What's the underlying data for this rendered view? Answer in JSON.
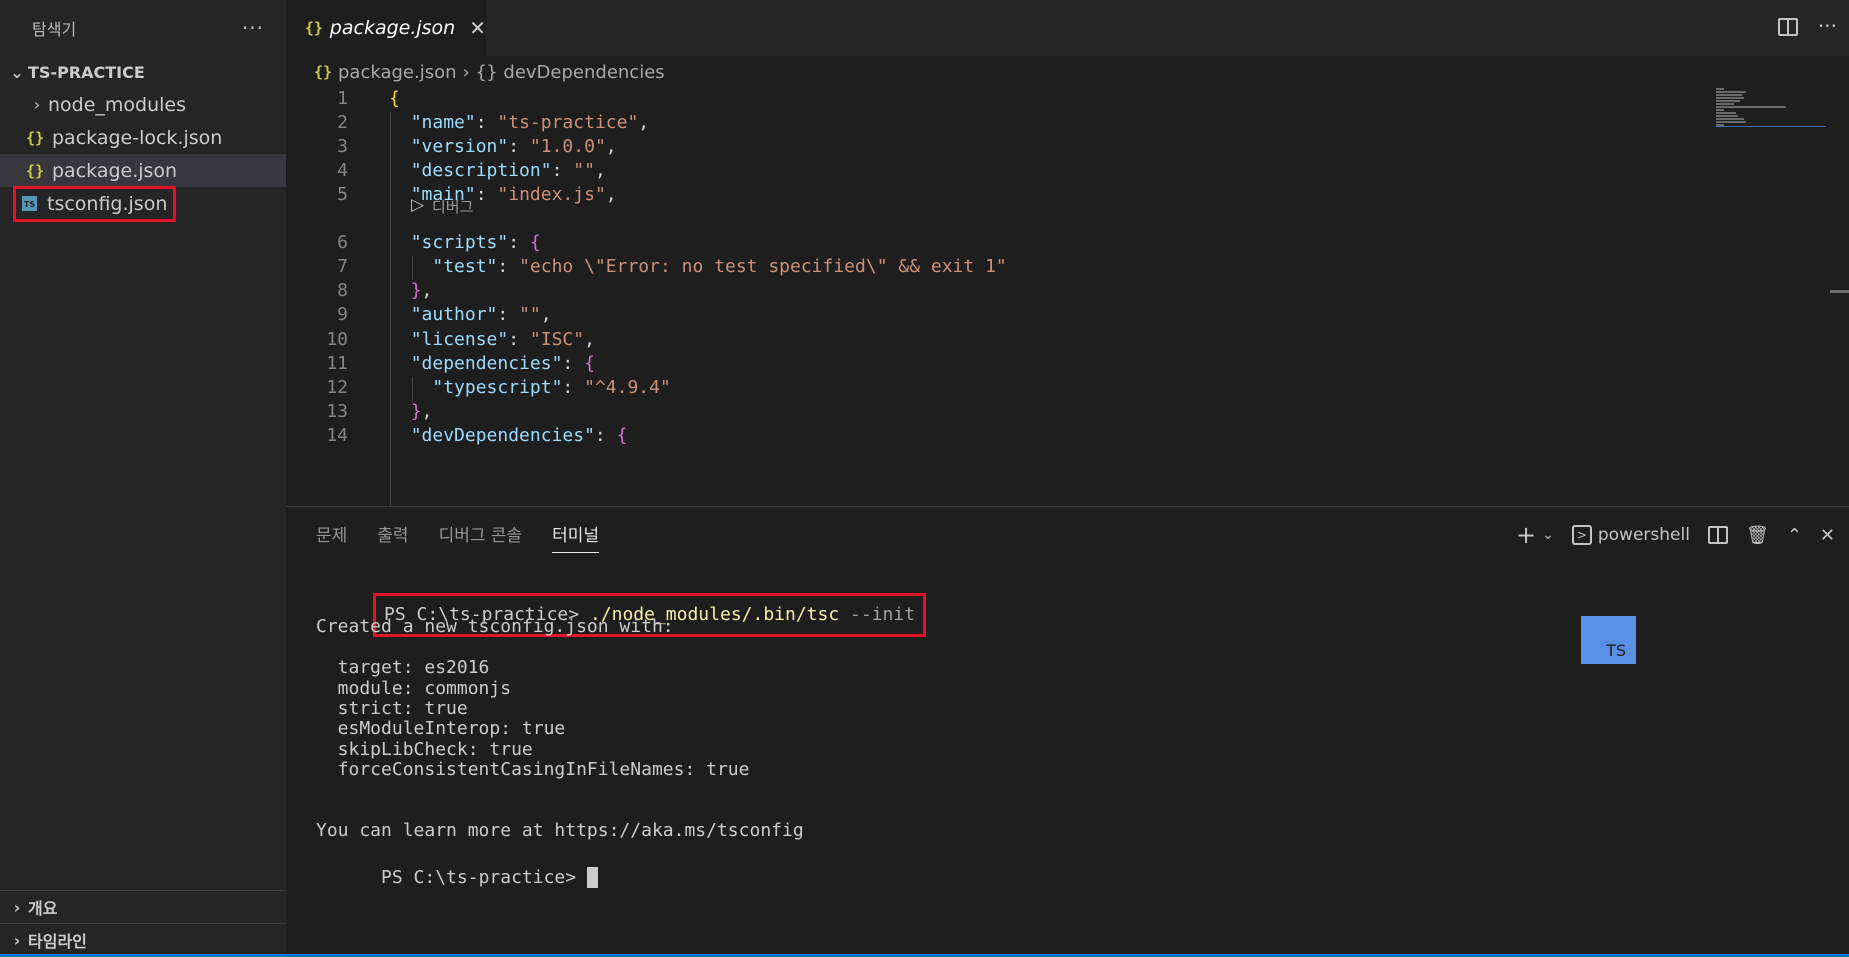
{
  "explorer": {
    "title": "탐색기",
    "more": "···",
    "folder": "TS-PRACTICE",
    "items": [
      {
        "label": "node_modules",
        "kind": "folder"
      },
      {
        "label": "package-lock.json",
        "kind": "json"
      },
      {
        "label": "package.json",
        "kind": "json"
      },
      {
        "label": "tsconfig.json",
        "kind": "ts"
      }
    ],
    "outline": "개요",
    "timeline": "타임라인"
  },
  "editor": {
    "tab_label": "package.json",
    "breadcrumb": [
      "package.json",
      "devDependencies"
    ],
    "codelens": "디버그",
    "lines": [
      {
        "n": "1",
        "parts": [
          [
            "b1",
            "{"
          ]
        ]
      },
      {
        "n": "2",
        "parts": [
          [
            "p",
            "  "
          ],
          [
            "k",
            "\"name\""
          ],
          [
            "p",
            ": "
          ],
          [
            "s",
            "\"ts-practice\""
          ],
          [
            "p",
            ","
          ]
        ]
      },
      {
        "n": "3",
        "parts": [
          [
            "p",
            "  "
          ],
          [
            "k",
            "\"version\""
          ],
          [
            "p",
            ": "
          ],
          [
            "s",
            "\"1.0.0\""
          ],
          [
            "p",
            ","
          ]
        ]
      },
      {
        "n": "4",
        "parts": [
          [
            "p",
            "  "
          ],
          [
            "k",
            "\"description\""
          ],
          [
            "p",
            ": "
          ],
          [
            "s",
            "\"\""
          ],
          [
            "p",
            ","
          ]
        ]
      },
      {
        "n": "5",
        "parts": [
          [
            "p",
            "  "
          ],
          [
            "k",
            "\"main\""
          ],
          [
            "p",
            ": "
          ],
          [
            "s",
            "\"index.js\""
          ],
          [
            "p",
            ","
          ]
        ]
      },
      {
        "n": "6",
        "parts": [
          [
            "p",
            "  "
          ],
          [
            "k",
            "\"scripts\""
          ],
          [
            "p",
            ": "
          ],
          [
            "b2",
            "{"
          ]
        ]
      },
      {
        "n": "7",
        "parts": [
          [
            "p",
            "    "
          ],
          [
            "k",
            "\"test\""
          ],
          [
            "p",
            ": "
          ],
          [
            "s",
            "\"echo \\\"Error: no test specified\\\" && exit 1\""
          ]
        ]
      },
      {
        "n": "8",
        "parts": [
          [
            "p",
            "  "
          ],
          [
            "b2",
            "}"
          ],
          [
            "p",
            ","
          ]
        ]
      },
      {
        "n": "9",
        "parts": [
          [
            "p",
            "  "
          ],
          [
            "k",
            "\"author\""
          ],
          [
            "p",
            ": "
          ],
          [
            "s",
            "\"\""
          ],
          [
            "p",
            ","
          ]
        ]
      },
      {
        "n": "10",
        "parts": [
          [
            "p",
            "  "
          ],
          [
            "k",
            "\"license\""
          ],
          [
            "p",
            ": "
          ],
          [
            "s",
            "\"ISC\""
          ],
          [
            "p",
            ","
          ]
        ]
      },
      {
        "n": "11",
        "parts": [
          [
            "p",
            "  "
          ],
          [
            "k",
            "\"dependencies\""
          ],
          [
            "p",
            ": "
          ],
          [
            "b2",
            "{"
          ]
        ]
      },
      {
        "n": "12",
        "parts": [
          [
            "p",
            "    "
          ],
          [
            "k",
            "\"typescript\""
          ],
          [
            "p",
            ": "
          ],
          [
            "s",
            "\"^4.9.4\""
          ]
        ]
      },
      {
        "n": "13",
        "parts": [
          [
            "p",
            "  "
          ],
          [
            "b2",
            "}"
          ],
          [
            "p",
            ","
          ]
        ]
      },
      {
        "n": "14",
        "parts": [
          [
            "p",
            "  "
          ],
          [
            "k",
            "\"devDependencies\""
          ],
          [
            "p",
            ": "
          ],
          [
            "b2",
            "{"
          ]
        ]
      }
    ]
  },
  "panel": {
    "tabs": [
      "문제",
      "출력",
      "디버그 콘솔",
      "터미널"
    ],
    "active_tab": "터미널",
    "shell": "powershell",
    "prompt": "PS C:\\ts-practice> ",
    "command": "./node_modules/.bin/tsc",
    "command_arg": " --init",
    "output": [
      "",
      "Created a new tsconfig.json with:",
      "",
      "  target: es2016",
      "  module: commonjs",
      "  strict: true",
      "  esModuleInterop: true",
      "  skipLibCheck: true",
      "  forceConsistentCasingInFileNames: true",
      "",
      "",
      "You can learn more at https://aka.ms/tsconfig"
    ],
    "final_prompt": "PS C:\\ts-practice> ",
    "ts_badge": "TS"
  }
}
